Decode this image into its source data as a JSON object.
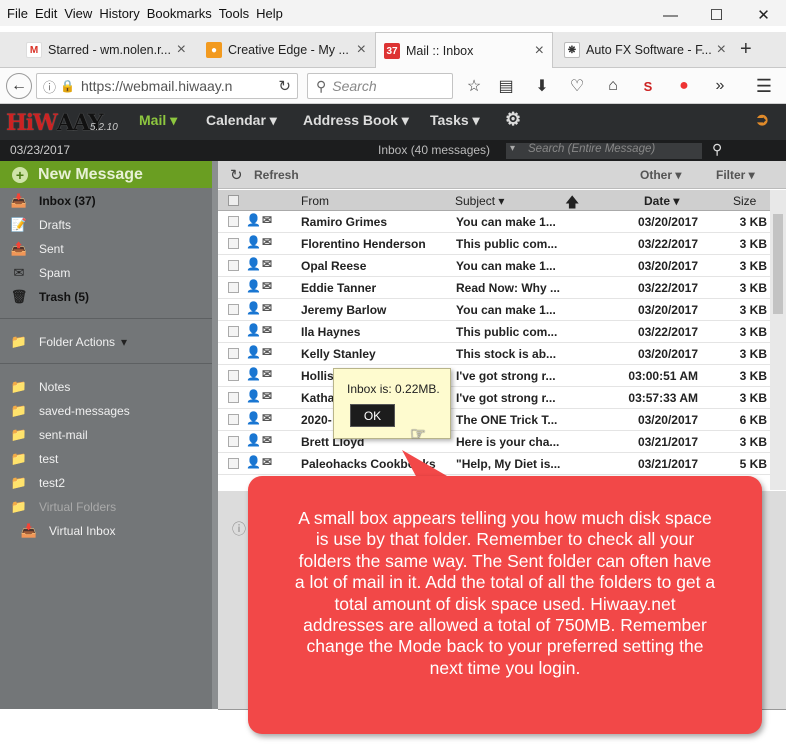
{
  "menu": {
    "file": "File",
    "edit": "Edit",
    "view": "View",
    "history": "History",
    "bookmarks": "Bookmarks",
    "tools": "Tools",
    "help": "Help"
  },
  "tabs": [
    {
      "label": "Starred - wm.nolen.r...",
      "icon": "gmail-icon"
    },
    {
      "label": "Creative Edge - My ...",
      "icon": "creative-edge-icon"
    },
    {
      "label": "Mail :: Inbox",
      "icon": "mail-badge-icon",
      "badge": "37"
    },
    {
      "label": "Auto FX Software - F...",
      "icon": "autofx-icon"
    }
  ],
  "nav": {
    "url": "https://webmail.hiwaay.n",
    "search_placeholder": "Search"
  },
  "app": {
    "logo_hi": "HiW",
    "logo_rest": "AAY",
    "version": "5.2.10",
    "mail": "Mail",
    "calendar": "Calendar",
    "address_book": "Address Book",
    "tasks": "Tasks",
    "date": "03/23/2017",
    "inbox_status": "Inbox (40 messages)",
    "search_placeholder": "Search (Entire Message)"
  },
  "sidebar": {
    "new_message": "New Message",
    "folders": [
      {
        "label": "Inbox (37)",
        "icon": "inbox-icon",
        "bold": true
      },
      {
        "label": "Drafts",
        "icon": "drafts-icon",
        "bold": false
      },
      {
        "label": "Sent",
        "icon": "sent-icon",
        "bold": false
      },
      {
        "label": "Spam",
        "icon": "spam-icon",
        "bold": false
      },
      {
        "label": "Trash (5)",
        "icon": "trash-icon",
        "bold": true
      }
    ],
    "folder_actions": "Folder Actions",
    "other_folders": [
      "Notes",
      "saved-messages",
      "sent-mail",
      "test",
      "test2"
    ],
    "virtual_folders": "Virtual Folders",
    "virtual_inbox": "Virtual Inbox"
  },
  "toolbar": {
    "refresh": "Refresh",
    "other": "Other",
    "filter": "Filter"
  },
  "columns": {
    "from": "From",
    "subject": "Subject",
    "date": "Date",
    "size": "Size"
  },
  "messages": [
    {
      "from": "Ramiro Grimes",
      "subject": "You can make 1...",
      "date": "03/20/2017",
      "size": "3 KB"
    },
    {
      "from": "Florentino Henderson",
      "subject": "This public com...",
      "date": "03/22/2017",
      "size": "3 KB"
    },
    {
      "from": "Opal Reese",
      "subject": "You can make 1...",
      "date": "03/20/2017",
      "size": "3 KB"
    },
    {
      "from": "Eddie Tanner",
      "subject": "Read Now: Why ...",
      "date": "03/22/2017",
      "size": "3 KB"
    },
    {
      "from": "Jeremy Barlow",
      "subject": "You can make 1...",
      "date": "03/20/2017",
      "size": "3 KB"
    },
    {
      "from": "Ila Haynes",
      "subject": "This public com...",
      "date": "03/22/2017",
      "size": "3 KB"
    },
    {
      "from": "Kelly Stanley",
      "subject": "This stock is ab...",
      "date": "03/20/2017",
      "size": "3 KB"
    },
    {
      "from": "Hollis",
      "subject": "I've got strong r...",
      "date": "03:00:51 AM",
      "size": "3 KB"
    },
    {
      "from": "Katha",
      "subject": "I've got strong r...",
      "date": "03:57:33 AM",
      "size": "3 KB"
    },
    {
      "from": "2020-",
      "subject": "The ONE Trick T...",
      "date": "03/20/2017",
      "size": "6 KB"
    },
    {
      "from": "Brett Lloyd",
      "subject": "Here is your cha...",
      "date": "03/21/2017",
      "size": "3 KB"
    },
    {
      "from": "Paleohacks Cookbooks",
      "subject": "\"Help, My Diet is...",
      "date": "03/21/2017",
      "size": "5 KB"
    }
  ],
  "popup": {
    "message": "Inbox is: 0.22MB.",
    "ok": "OK"
  },
  "callout": {
    "text": "A small box appears telling you how much disk space is use by that folder. Remember to check all your folders the same way. The Sent folder can often have a lot of mail in it. Add the total of all the folders to get a total amount of disk space used. Hiwaay.net addresses are allowed a total of 750MB. Remember change the Mode back to your preferred setting the next time you login."
  },
  "colors": {
    "accent_green": "#8dc63f",
    "new_message_bg": "#6a9e22",
    "callout_red": "#f24848",
    "popup_bg": "#fefbcf",
    "header_dark": "#2b2d2f",
    "sidebar_bg": "#737678"
  }
}
